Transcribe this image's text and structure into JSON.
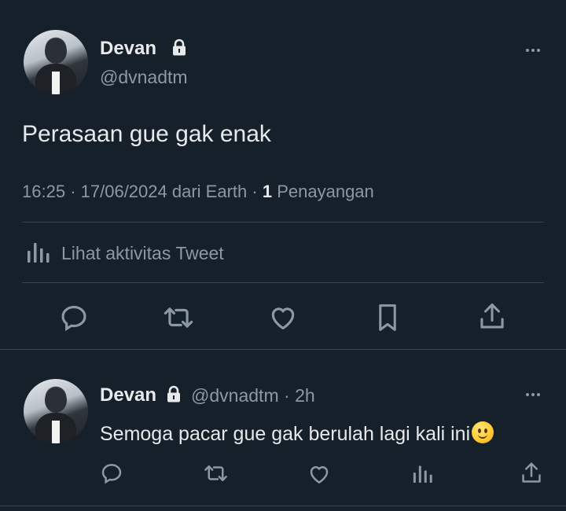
{
  "tweet": {
    "author_name": "Devan",
    "author_handle": "@dvnadtm",
    "text": "Perasaan gue gak enak",
    "meta": {
      "time": "16:25",
      "date": "17/06/2024",
      "source": "dari Earth",
      "views_count": "1",
      "views_label": "Penayangan"
    },
    "activity_label": "Lihat aktivitas Tweet",
    "icons": {
      "lock": "lock-icon",
      "more": "more-dots-icon",
      "analytics": "bar-chart-icon",
      "reply": "reply-icon",
      "retweet": "retweet-icon",
      "like": "heart-icon",
      "bookmark": "bookmark-icon",
      "share": "share-icon"
    }
  },
  "reply": {
    "author_name": "Devan",
    "author_handle": "@dvnadtm",
    "time_ago": "2h",
    "text": "Semoga pacar gue gak berulah lagi kali ini",
    "emoji": "slightly-smiling-face"
  },
  "colors": {
    "background": "#15202b",
    "text": "#e7e9ea",
    "muted": "#8b98a5",
    "divider": "#38444d"
  }
}
